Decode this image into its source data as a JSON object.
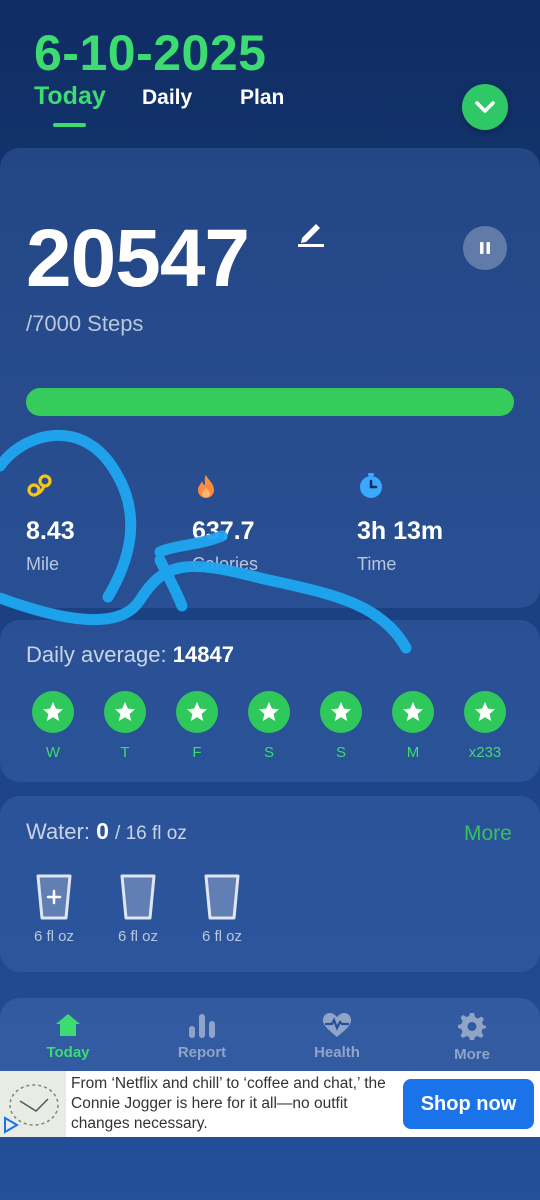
{
  "header": {
    "date": "6-10-2025",
    "tabs": [
      {
        "label": "Today",
        "active": true
      },
      {
        "label": "Daily",
        "active": false
      },
      {
        "label": "Plan",
        "active": false
      }
    ]
  },
  "steps": {
    "count": "20547",
    "goal_text": "/7000 Steps",
    "progress_fraction": 1.0
  },
  "stats": [
    {
      "value": "8.43",
      "label": "Mile",
      "icon": "distance-icon"
    },
    {
      "value": "637.7",
      "label": "Calories",
      "icon": "flame-icon"
    },
    {
      "value": "3h 13m",
      "label": "Time",
      "icon": "timer-icon"
    }
  ],
  "daily_average": {
    "label": "Daily average:",
    "value": "14847",
    "days": [
      "W",
      "T",
      "F",
      "S",
      "S",
      "M",
      "x233"
    ]
  },
  "water": {
    "label": "Water:",
    "current": "0",
    "total": "/ 16 fl oz",
    "more_label": "More",
    "cups": [
      "6 fl oz",
      "6 fl oz",
      "6 fl oz"
    ]
  },
  "nav": [
    {
      "label": "Today",
      "icon": "home-icon",
      "active": true
    },
    {
      "label": "Report",
      "icon": "bar-chart-icon",
      "active": false
    },
    {
      "label": "Health",
      "icon": "heart-pulse-icon",
      "active": false
    },
    {
      "label": "More",
      "icon": "gear-icon",
      "active": false
    }
  ],
  "ad": {
    "text": "From ‘Netflix and chill’ to ‘coffee and chat,’ the Connie Jogger is here for it all—no outfit changes necessary.",
    "button_label": "Shop now"
  },
  "colors": {
    "accent_green": "#3ddc71",
    "annotation_blue": "#1fa6f0",
    "ad_button": "#1a73e8"
  }
}
